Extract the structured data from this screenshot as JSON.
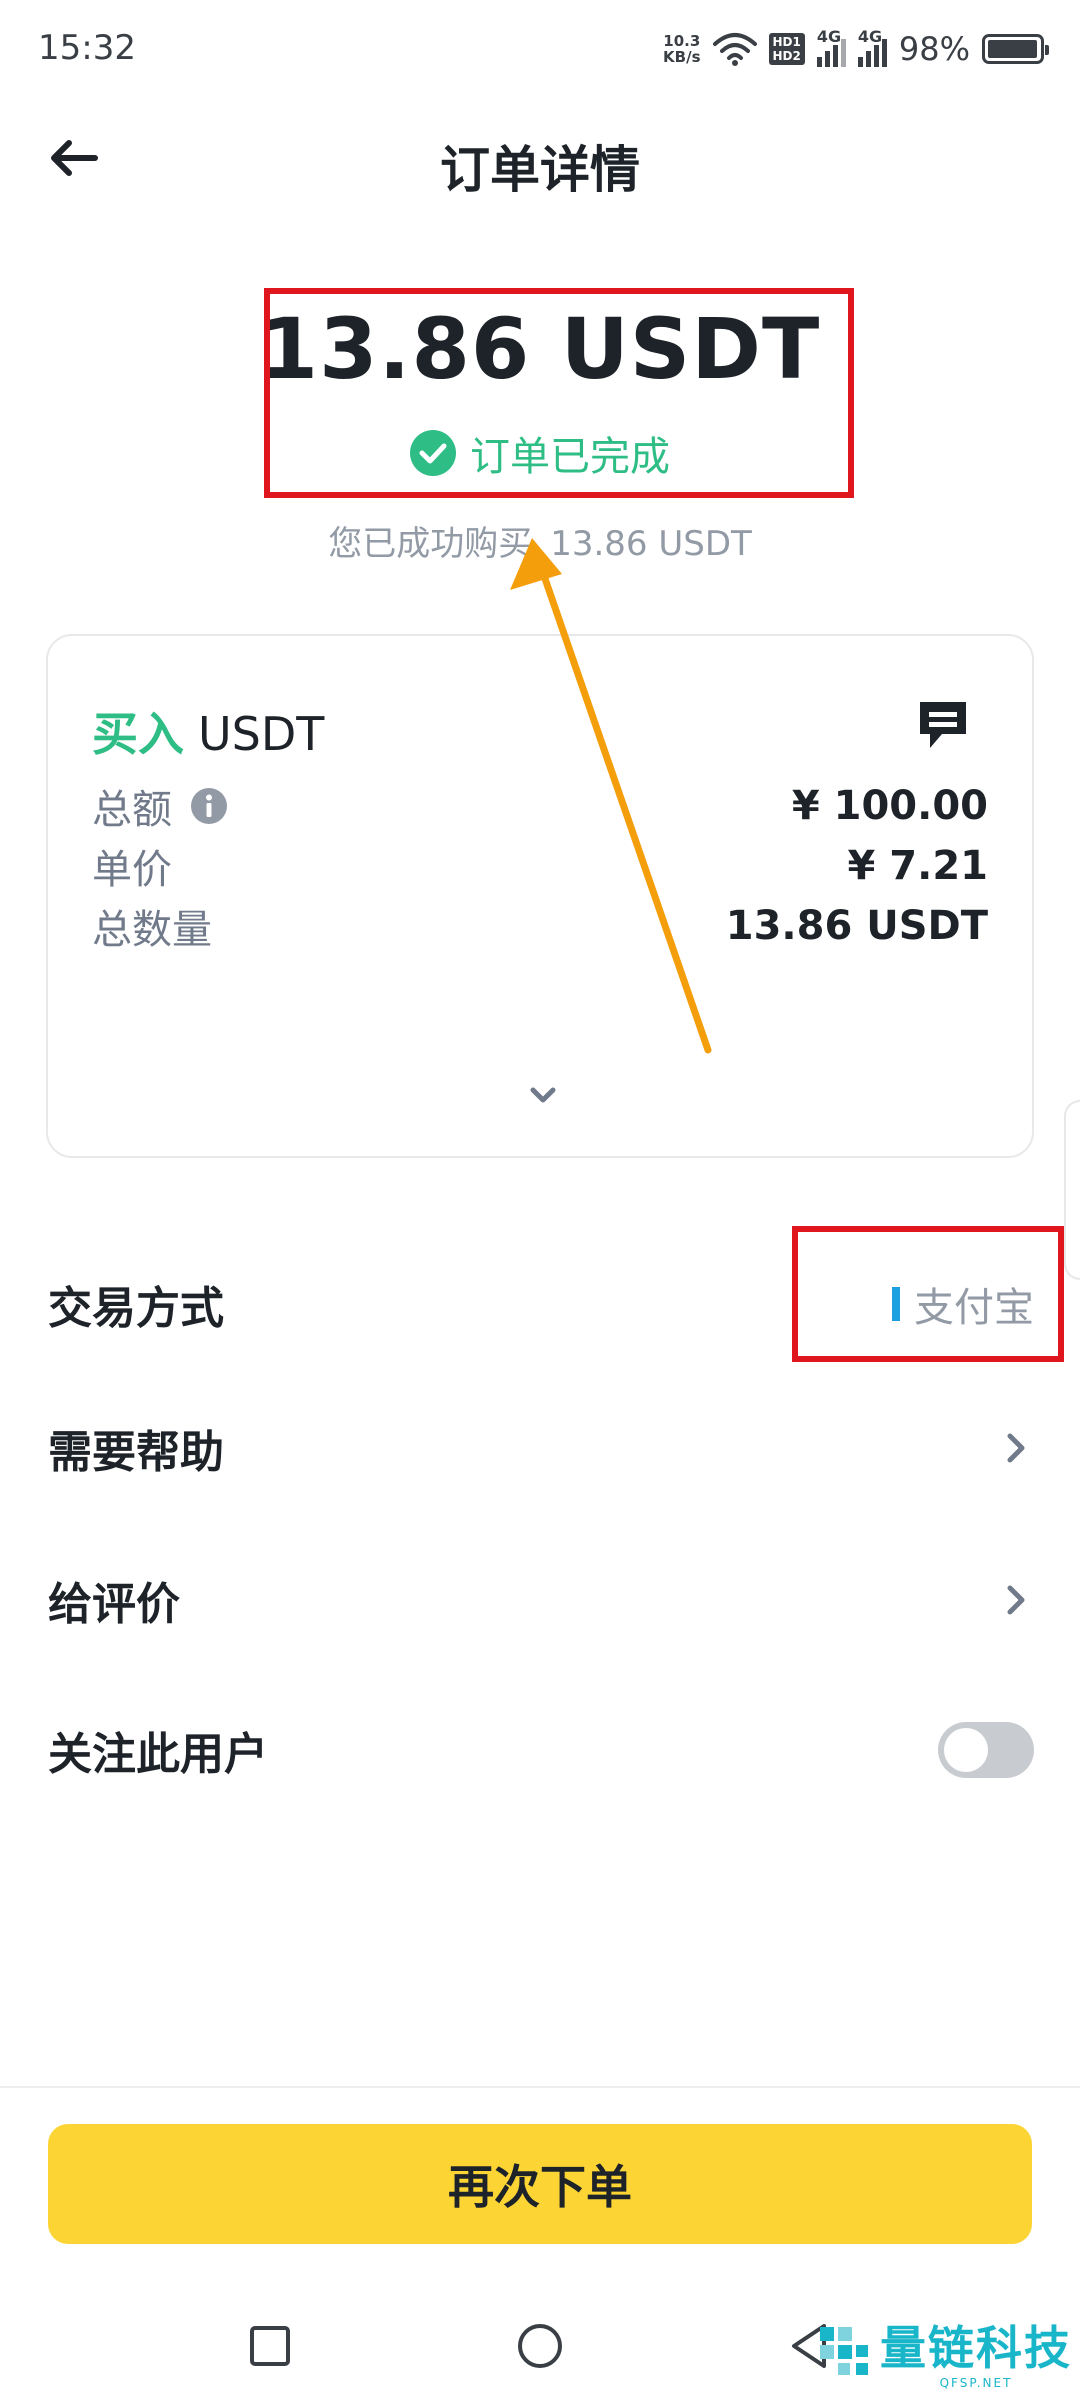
{
  "status_bar": {
    "time": "15:32",
    "net_speed_value": "10.3",
    "net_speed_unit": "KB/s",
    "hd_top": "HD1",
    "hd_bottom": "HD2",
    "signal1_label": "4G",
    "signal2_label": "4G",
    "battery_percent_text": "98%",
    "battery_level": 0.98
  },
  "header": {
    "title": "订单详情"
  },
  "summary": {
    "amount": "13.86 USDT",
    "status": "订单已完成",
    "status_color": "#2ebd85",
    "sub_text": "您已成功购买",
    "sub_amount": "13.86 USDT"
  },
  "order_card": {
    "side": "买入",
    "asset": "USDT",
    "rows": [
      {
        "label": "总额",
        "value": "¥ 100.00",
        "has_info_icon": true
      },
      {
        "label": "单价",
        "value": "¥ 7.21",
        "has_info_icon": false
      },
      {
        "label": "总数量",
        "value": "13.86 USDT",
        "has_info_icon": false
      }
    ]
  },
  "settings": {
    "trade_method_label": "交易方式",
    "trade_method_value": "支付宝",
    "help_label": "需要帮助",
    "review_label": "给评价",
    "follow_label": "关注此用户",
    "follow_enabled": false
  },
  "actions": {
    "reorder_label": "再次下单",
    "reorder_color": "#fcd535"
  },
  "watermark": {
    "title": "量链科技",
    "subtitle": "QFSP.NET"
  },
  "icons": [
    "back-arrow-icon",
    "check-circle-icon",
    "chat-icon",
    "info-icon",
    "chevron-down-icon",
    "chevron-right-icon",
    "square-icon",
    "circle-icon",
    "triangle-back-icon"
  ],
  "annotation_color": "#e0161f",
  "arrow_color": "#f59e0b"
}
